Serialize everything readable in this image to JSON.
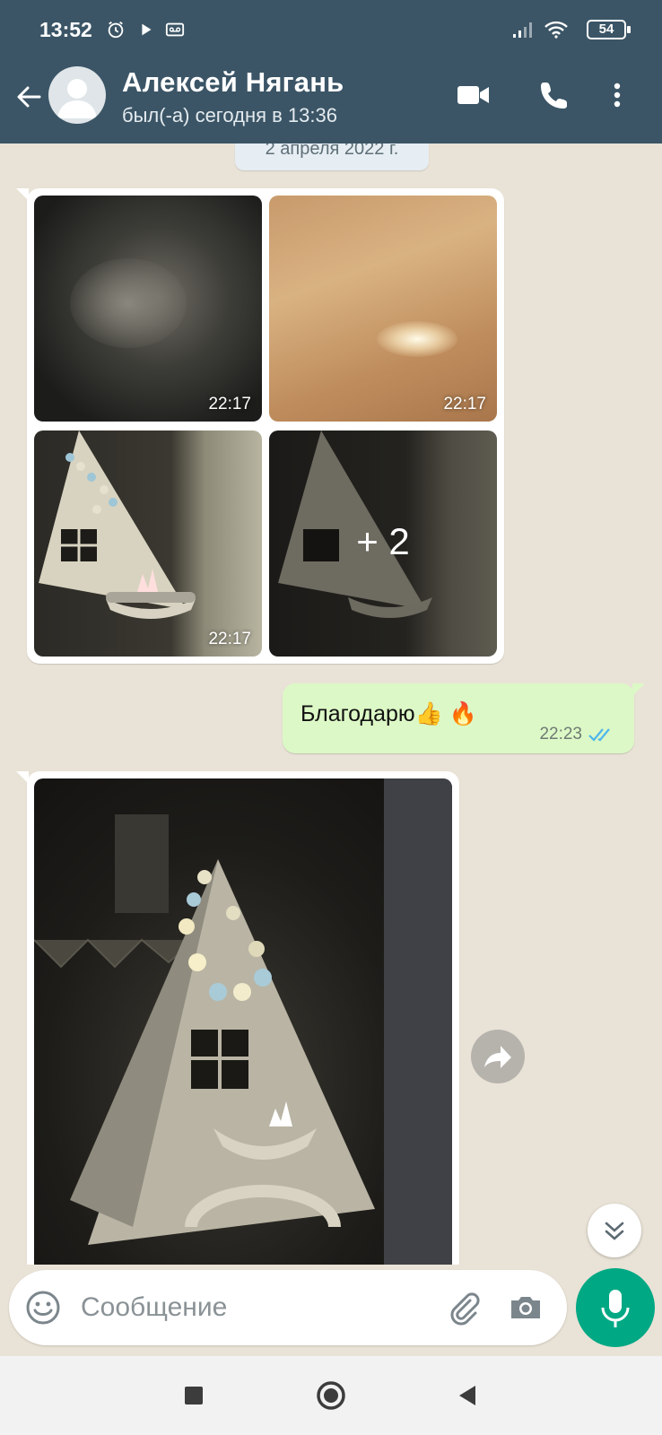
{
  "status_bar": {
    "time": "13:52",
    "battery": "54",
    "icons": [
      "alarm-icon",
      "play-icon",
      "voicemail-icon",
      "signal-icon",
      "wifi-icon",
      "battery-icon"
    ]
  },
  "header": {
    "contact_name": "Алексей Нягань",
    "contact_status": "был(-а) сегодня в 13:36",
    "icons": [
      "back-arrow-icon",
      "avatar-placeholder-icon",
      "video-call-icon",
      "phone-icon",
      "more-vert-icon"
    ]
  },
  "chat": {
    "date_label": "2 апреля 2022 г.",
    "album": {
      "photos": [
        {
          "time": "22:17"
        },
        {
          "time": "22:17"
        },
        {
          "time": "22:17"
        },
        {
          "more": "+ 2"
        }
      ]
    },
    "outgoing": {
      "text": "Благодарю👍 🔥",
      "time": "22:23",
      "status_icon": "double-check-read-icon"
    },
    "incoming_photo": {
      "action_icon": "forward-icon"
    },
    "scroll_icon": "double-chevron-down-icon"
  },
  "input": {
    "placeholder": "Сообщение",
    "icons": [
      "emoji-icon",
      "attach-icon",
      "camera-icon",
      "mic-icon"
    ]
  },
  "colors": {
    "header": "#3b5566",
    "outgoing_bubble": "#dcf8c6",
    "incoming_bubble": "#ffffff",
    "wallpaper": "#e9e2d6",
    "mic": "#00a884",
    "read_ticks": "#4fb6ec"
  },
  "nav_bar": {
    "icons": [
      "recents-square-icon",
      "home-circle-icon",
      "back-triangle-icon"
    ]
  }
}
